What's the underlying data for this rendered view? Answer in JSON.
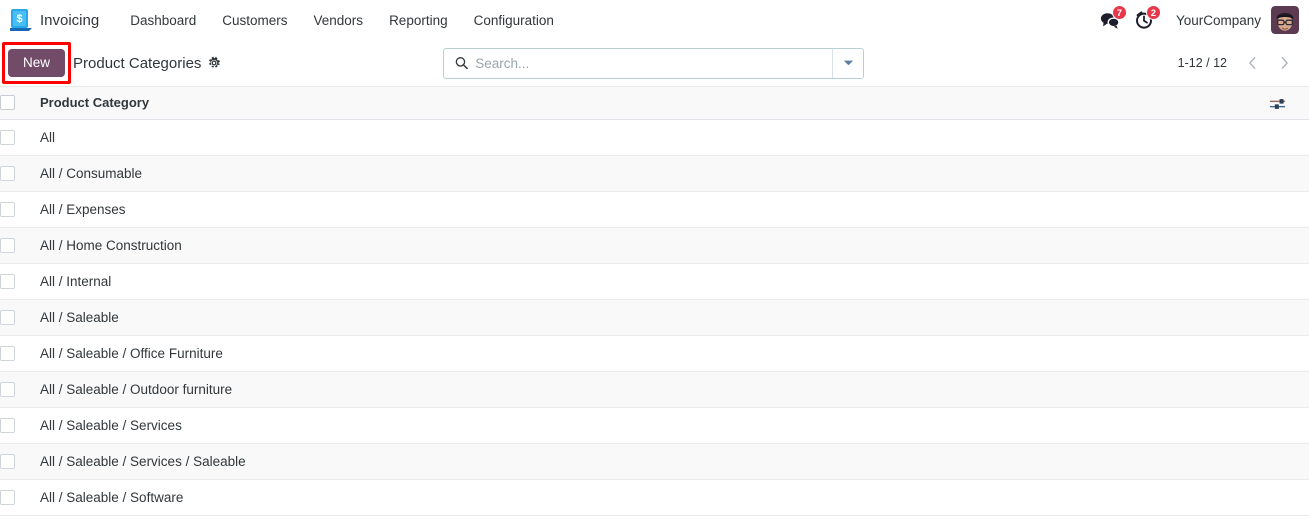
{
  "navbar": {
    "app_icon_name": "invoicing-app-icon",
    "app_name": "Invoicing",
    "menu_items": [
      {
        "label": "Dashboard"
      },
      {
        "label": "Customers"
      },
      {
        "label": "Vendors"
      },
      {
        "label": "Reporting"
      },
      {
        "label": "Configuration"
      }
    ],
    "messages": {
      "icon": "chat-bubbles-icon",
      "badge": "7"
    },
    "activities": {
      "icon": "clock-activity-icon",
      "badge": "2"
    },
    "company": "YourCompany",
    "avatar_name": "user-avatar"
  },
  "control_panel": {
    "new_label": "New",
    "title": "Product Categories",
    "gear_icon": "gear-icon",
    "search": {
      "icon": "search-icon",
      "value": "",
      "placeholder": "Search...",
      "toggle_icon": "caret-down-icon"
    },
    "pager": {
      "label": "1-12 / 12",
      "prev_icon": "chevron-left-icon",
      "next_icon": "chevron-right-icon"
    }
  },
  "list": {
    "columns": [
      "Product Category"
    ],
    "options_icon": "sliders-icon",
    "rows": [
      {
        "name": "All"
      },
      {
        "name": "All / Consumable"
      },
      {
        "name": "All / Expenses"
      },
      {
        "name": "All / Home Construction"
      },
      {
        "name": "All / Internal"
      },
      {
        "name": "All / Saleable"
      },
      {
        "name": "All / Saleable / Office Furniture"
      },
      {
        "name": "All / Saleable / Outdoor furniture"
      },
      {
        "name": "All / Saleable / Services"
      },
      {
        "name": "All / Saleable / Services / Saleable"
      },
      {
        "name": "All / Saleable / Software"
      }
    ]
  },
  "colors": {
    "brand_purple": "#714B67",
    "badge_red": "#E6384A",
    "text_dark": "#31373B",
    "row_band": "#F9F9F9",
    "focus_ring": "#FF0000"
  }
}
